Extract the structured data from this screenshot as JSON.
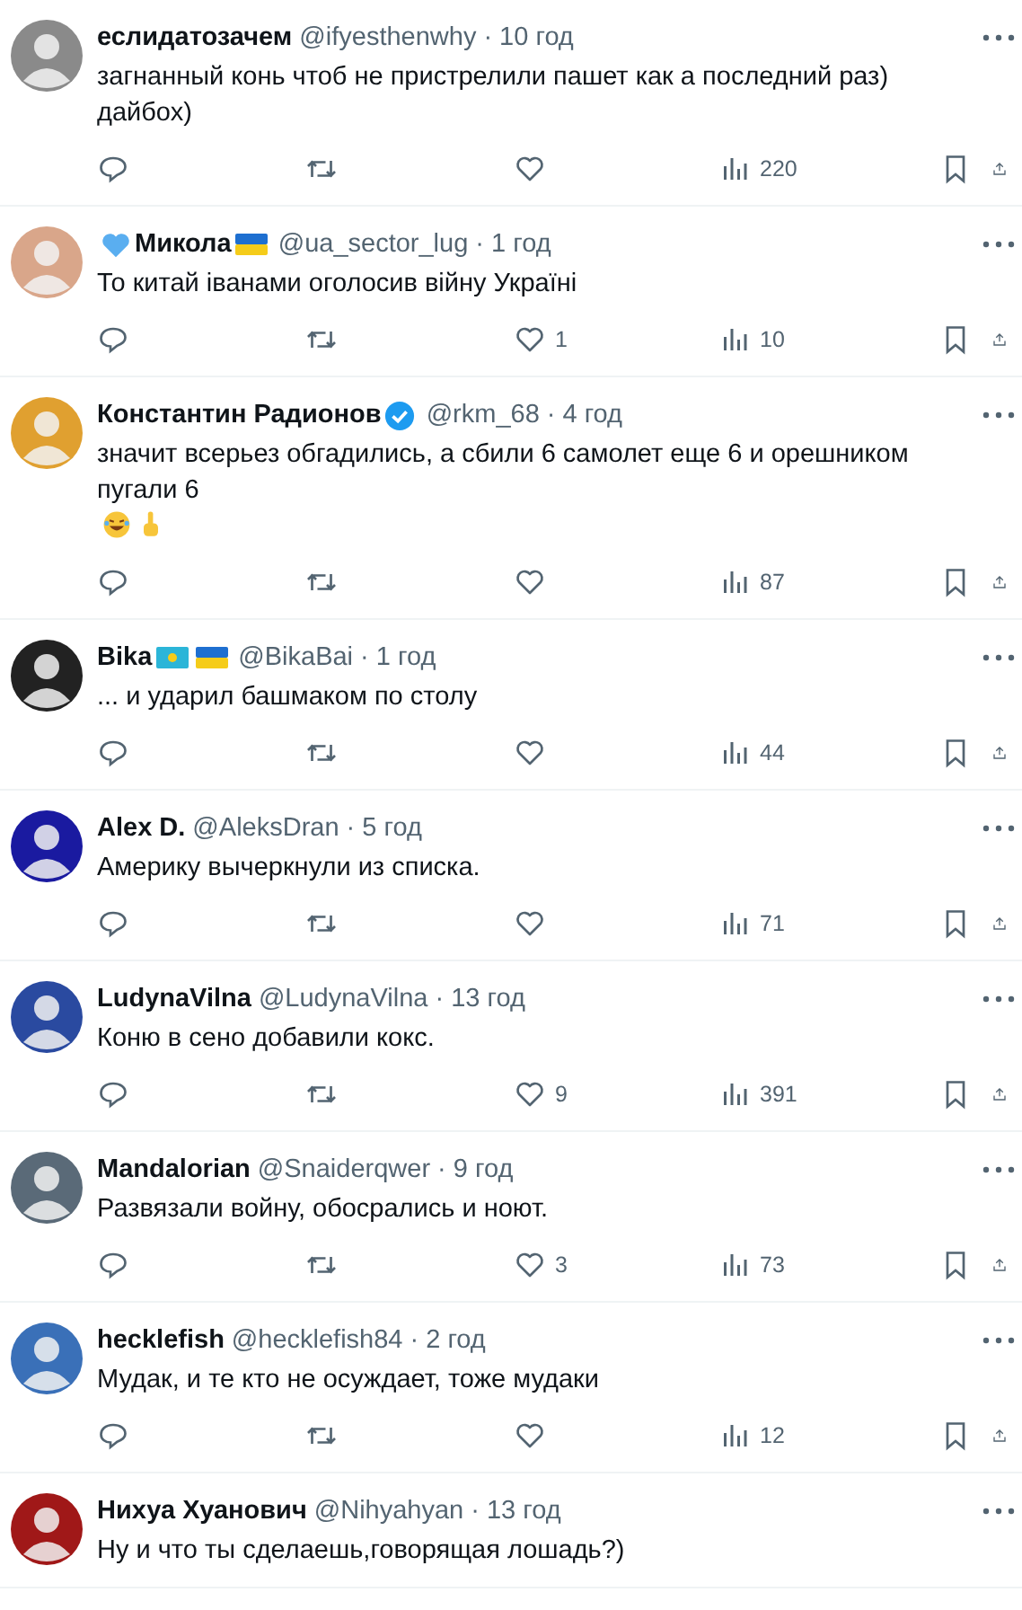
{
  "replies": [
    {
      "color": "#8a8a8a",
      "name": "еслидатозачем",
      "handle": "@ifyesthenwhy",
      "time": "· 10 год",
      "text": "загнанный конь чтоб не пристрелили пашет как а последний раз) дайбох)",
      "actions": {
        "views": "220"
      }
    },
    {
      "color": "#d9a68a",
      "name": "Микола",
      "prefix": [
        {
          "kind": "heart"
        }
      ],
      "badges": [
        {
          "kind": "flag-ua"
        }
      ],
      "handle": "@ua_sector_lug",
      "time": "· 1 год",
      "text": "То китай іванами оголосив війну Україні",
      "actions": {
        "likes": "1",
        "views": "10"
      }
    },
    {
      "color": "#e0a030",
      "name": "Константин Радионов",
      "badges": [
        {
          "kind": "verified"
        }
      ],
      "handle": "@rkm_68",
      "time": "· 4 год",
      "text": "значит всерьез обгадились, а сбили 6 самолет еще 6 и орешником пугали 6",
      "emoji": [
        {
          "kind": "rofl"
        },
        {
          "kind": "point-up"
        }
      ],
      "actions": {
        "views": "87"
      }
    },
    {
      "color": "#222222",
      "name": "Bika",
      "badges": [
        {
          "kind": "flag-kz"
        },
        {
          "kind": "flag-ua"
        }
      ],
      "handle": "@BikaBai",
      "time": "· 1 год",
      "text": "... и ударил башмаком по столу",
      "actions": {
        "views": "44"
      }
    },
    {
      "color": "#1a1aa0",
      "name": "Alex D.",
      "handle": "@AleksDran",
      "time": "· 5 год",
      "text": "Америку вычеркнули из списка.",
      "actions": {
        "views": "71"
      }
    },
    {
      "color": "#2a4aa0",
      "name": "LudynaVilna",
      "handle": "@LudynaVilna",
      "time": "· 13 год",
      "text": "Коню в сено добавили кокс.",
      "actions": {
        "likes": "9",
        "views": "391"
      }
    },
    {
      "color": "#5a6a78",
      "name": "Mandalorian",
      "handle": "@Snaiderqwer",
      "time": "· 9 год",
      "text": "Развязали войну, обосрались и ноют.",
      "actions": {
        "likes": "3",
        "views": "73"
      }
    },
    {
      "color": "#3a70b8",
      "name": "hecklefish",
      "handle": "@hecklefish84",
      "time": "· 2 год",
      "text": "Мудак, и те кто не осуждает, тоже мудаки",
      "actions": {
        "views": "12"
      }
    },
    {
      "color": "#a01818",
      "name": "Нихуа Хуанович",
      "handle": "@Nihyahyan",
      "time": "· 13 год",
      "text": "Ну и что ты сделаешь,говорящая лошадь?)"
    }
  ]
}
